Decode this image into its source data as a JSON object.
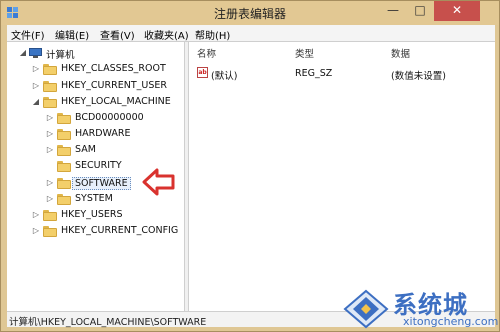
{
  "window": {
    "title": "注册表编辑器",
    "minimize_glyph": "—",
    "maximize_glyph": "□",
    "close_glyph": "✕"
  },
  "menu": [
    {
      "label": "文件(F)"
    },
    {
      "label": "编辑(E)"
    },
    {
      "label": "查看(V)"
    },
    {
      "label": "收藏夹(A)"
    },
    {
      "label": "帮助(H)"
    }
  ],
  "tree": {
    "root": {
      "label": "计算机",
      "expander": "◢"
    },
    "nodes": [
      {
        "label": "HKEY_CLASSES_ROOT",
        "expander": "▷"
      },
      {
        "label": "HKEY_CURRENT_USER",
        "expander": "▷"
      },
      {
        "label": "HKEY_LOCAL_MACHINE",
        "expander": "◢"
      },
      {
        "label": "BCD00000000",
        "expander": "▷"
      },
      {
        "label": "HARDWARE",
        "expander": "▷"
      },
      {
        "label": "SAM",
        "expander": "▷"
      },
      {
        "label": "SECURITY",
        "expander": ""
      },
      {
        "label": "SOFTWARE",
        "expander": "▷",
        "selected": true
      },
      {
        "label": "SYSTEM",
        "expander": "▷"
      },
      {
        "label": "HKEY_USERS",
        "expander": "▷"
      },
      {
        "label": "HKEY_CURRENT_CONFIG",
        "expander": "▷"
      }
    ]
  },
  "list": {
    "columns": [
      "名称",
      "类型",
      "数据"
    ],
    "rows": [
      {
        "name": "(默认)",
        "type": "REG_SZ",
        "data": "(数值未设置)",
        "icon": "ab-string-icon"
      }
    ]
  },
  "status": {
    "path": "计算机\\HKEY_LOCAL_MACHINE\\SOFTWARE"
  },
  "watermark": {
    "text": "系统城",
    "url": "xitongcheng.com"
  },
  "colors": {
    "annotation_arrow": "#d9322e",
    "watermark_blue": "#3d6fc2",
    "close_button": "#c7504c"
  }
}
